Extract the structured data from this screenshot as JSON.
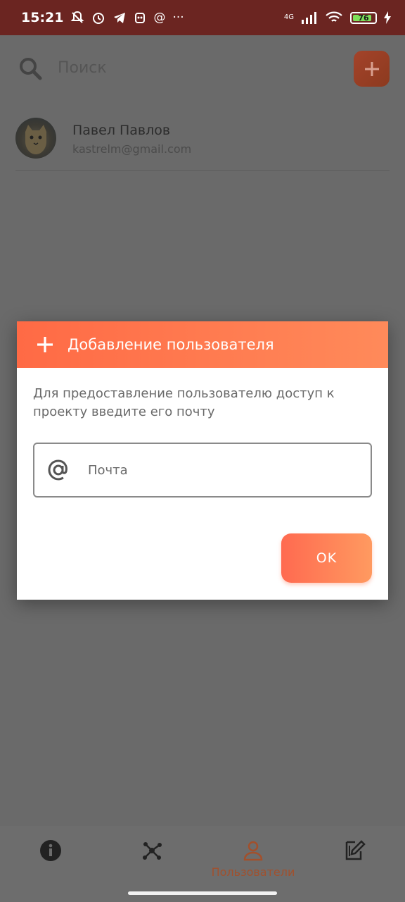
{
  "status_bar": {
    "time": "15:21",
    "network": "4G",
    "battery_level": "76",
    "more_indicator": "···",
    "at_sign": "@"
  },
  "search": {
    "placeholder": "Поиск",
    "icon": "search-icon"
  },
  "users": [
    {
      "name": "Павел Павлов",
      "email": "kastrelm@gmail.com"
    }
  ],
  "dialog": {
    "title": "Добавление пользователя",
    "description": "Для предоставление пользователю доступ к проекту введите его почту",
    "email_placeholder": "Почта",
    "ok_label": "OK",
    "header_color": "#ff6f4b"
  },
  "bottom_nav": {
    "items": [
      {
        "icon": "info-icon",
        "label": ""
      },
      {
        "icon": "graph-icon",
        "label": ""
      },
      {
        "icon": "user-icon",
        "label": "Пользователи",
        "active": true
      },
      {
        "icon": "edit-icon",
        "label": ""
      }
    ]
  },
  "colors": {
    "accent": "#ff6f4b",
    "overlay": "#6a6a6a",
    "status_bar": "#6b2521"
  }
}
